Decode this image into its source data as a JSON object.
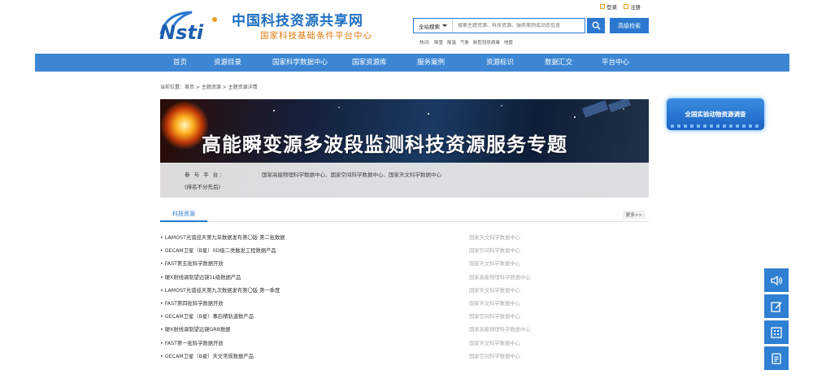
{
  "header": {
    "site_title": "中国科技资源共享网",
    "site_subtitle": "国家科技基础条件平台中心",
    "login": "登录",
    "register": "注册"
  },
  "search": {
    "scope": "全站搜索",
    "placeholder": "搜索主题资源、科技资源、服务案例或动态信息",
    "advanced": "高级检索",
    "hot_label": "热词:",
    "hot_words": [
      "降雪",
      "降温",
      "气象",
      "新型冠状病毒",
      "地震"
    ]
  },
  "nav": [
    "首页",
    "资源目录",
    "国家科学数据中心",
    "国家资源库",
    "服务案例",
    "资源标识",
    "数据汇交",
    "平台中心"
  ],
  "breadcrumb": "当前位置：首页 > 主题资源 > 主题资源详情",
  "banner": {
    "title": "高能瞬变源多波段监测科技资源服务专题",
    "platform_label": "参 与 平 台：",
    "platforms": "国家高能物理科学数据中心、国家空间科学数据中心、国家天文科学数据中心",
    "note": "(排名不分先后)"
  },
  "survey": "全国实验动物资源调查",
  "tabs": {
    "active": "科技资源",
    "more": "更多>>"
  },
  "resources": [
    {
      "title": "• LAMOST光谱巡天第九年数据发布第〇版 第二批数据",
      "source": "国家天文科学数据中心"
    },
    {
      "title": "• GECAM卫星（B星）0D级二类触发工程数据产品",
      "source": "国家空间科学数据中心"
    },
    {
      "title": "• FAST第五批科学数据开放",
      "source": "国家天文科学数据中心"
    },
    {
      "title": "• 硬X射线调制望远镜1L级数据产品",
      "source": "国家高能物理科学数据中心"
    },
    {
      "title": "• LAMOST光谱巡天第九次数据发布第〇版 第一季度",
      "source": "国家天文科学数据中心"
    },
    {
      "title": "• FAST第四批科学数据开放",
      "source": "国家天文科学数据中心"
    },
    {
      "title": "• GECAM卫星（B星）事后精轨道数产品",
      "source": "国家空间科学数据中心"
    },
    {
      "title": "• 硬X射线调制望远镜GRB数据",
      "source": "国家高能物理科学数据中心"
    },
    {
      "title": "• FAST第一批科学数据开放",
      "source": "国家天文科学数据中心"
    },
    {
      "title": "• GECAM卫星（B星）天文常规数据产品",
      "source": "国家空间科学数据中心"
    }
  ],
  "side_tools": [
    "speaker-icon",
    "edit-icon",
    "qrcode-icon",
    "document-icon"
  ],
  "colors": {
    "primary": "#3c86d3",
    "accent": "#e07a10",
    "link": "#2c78d0"
  }
}
